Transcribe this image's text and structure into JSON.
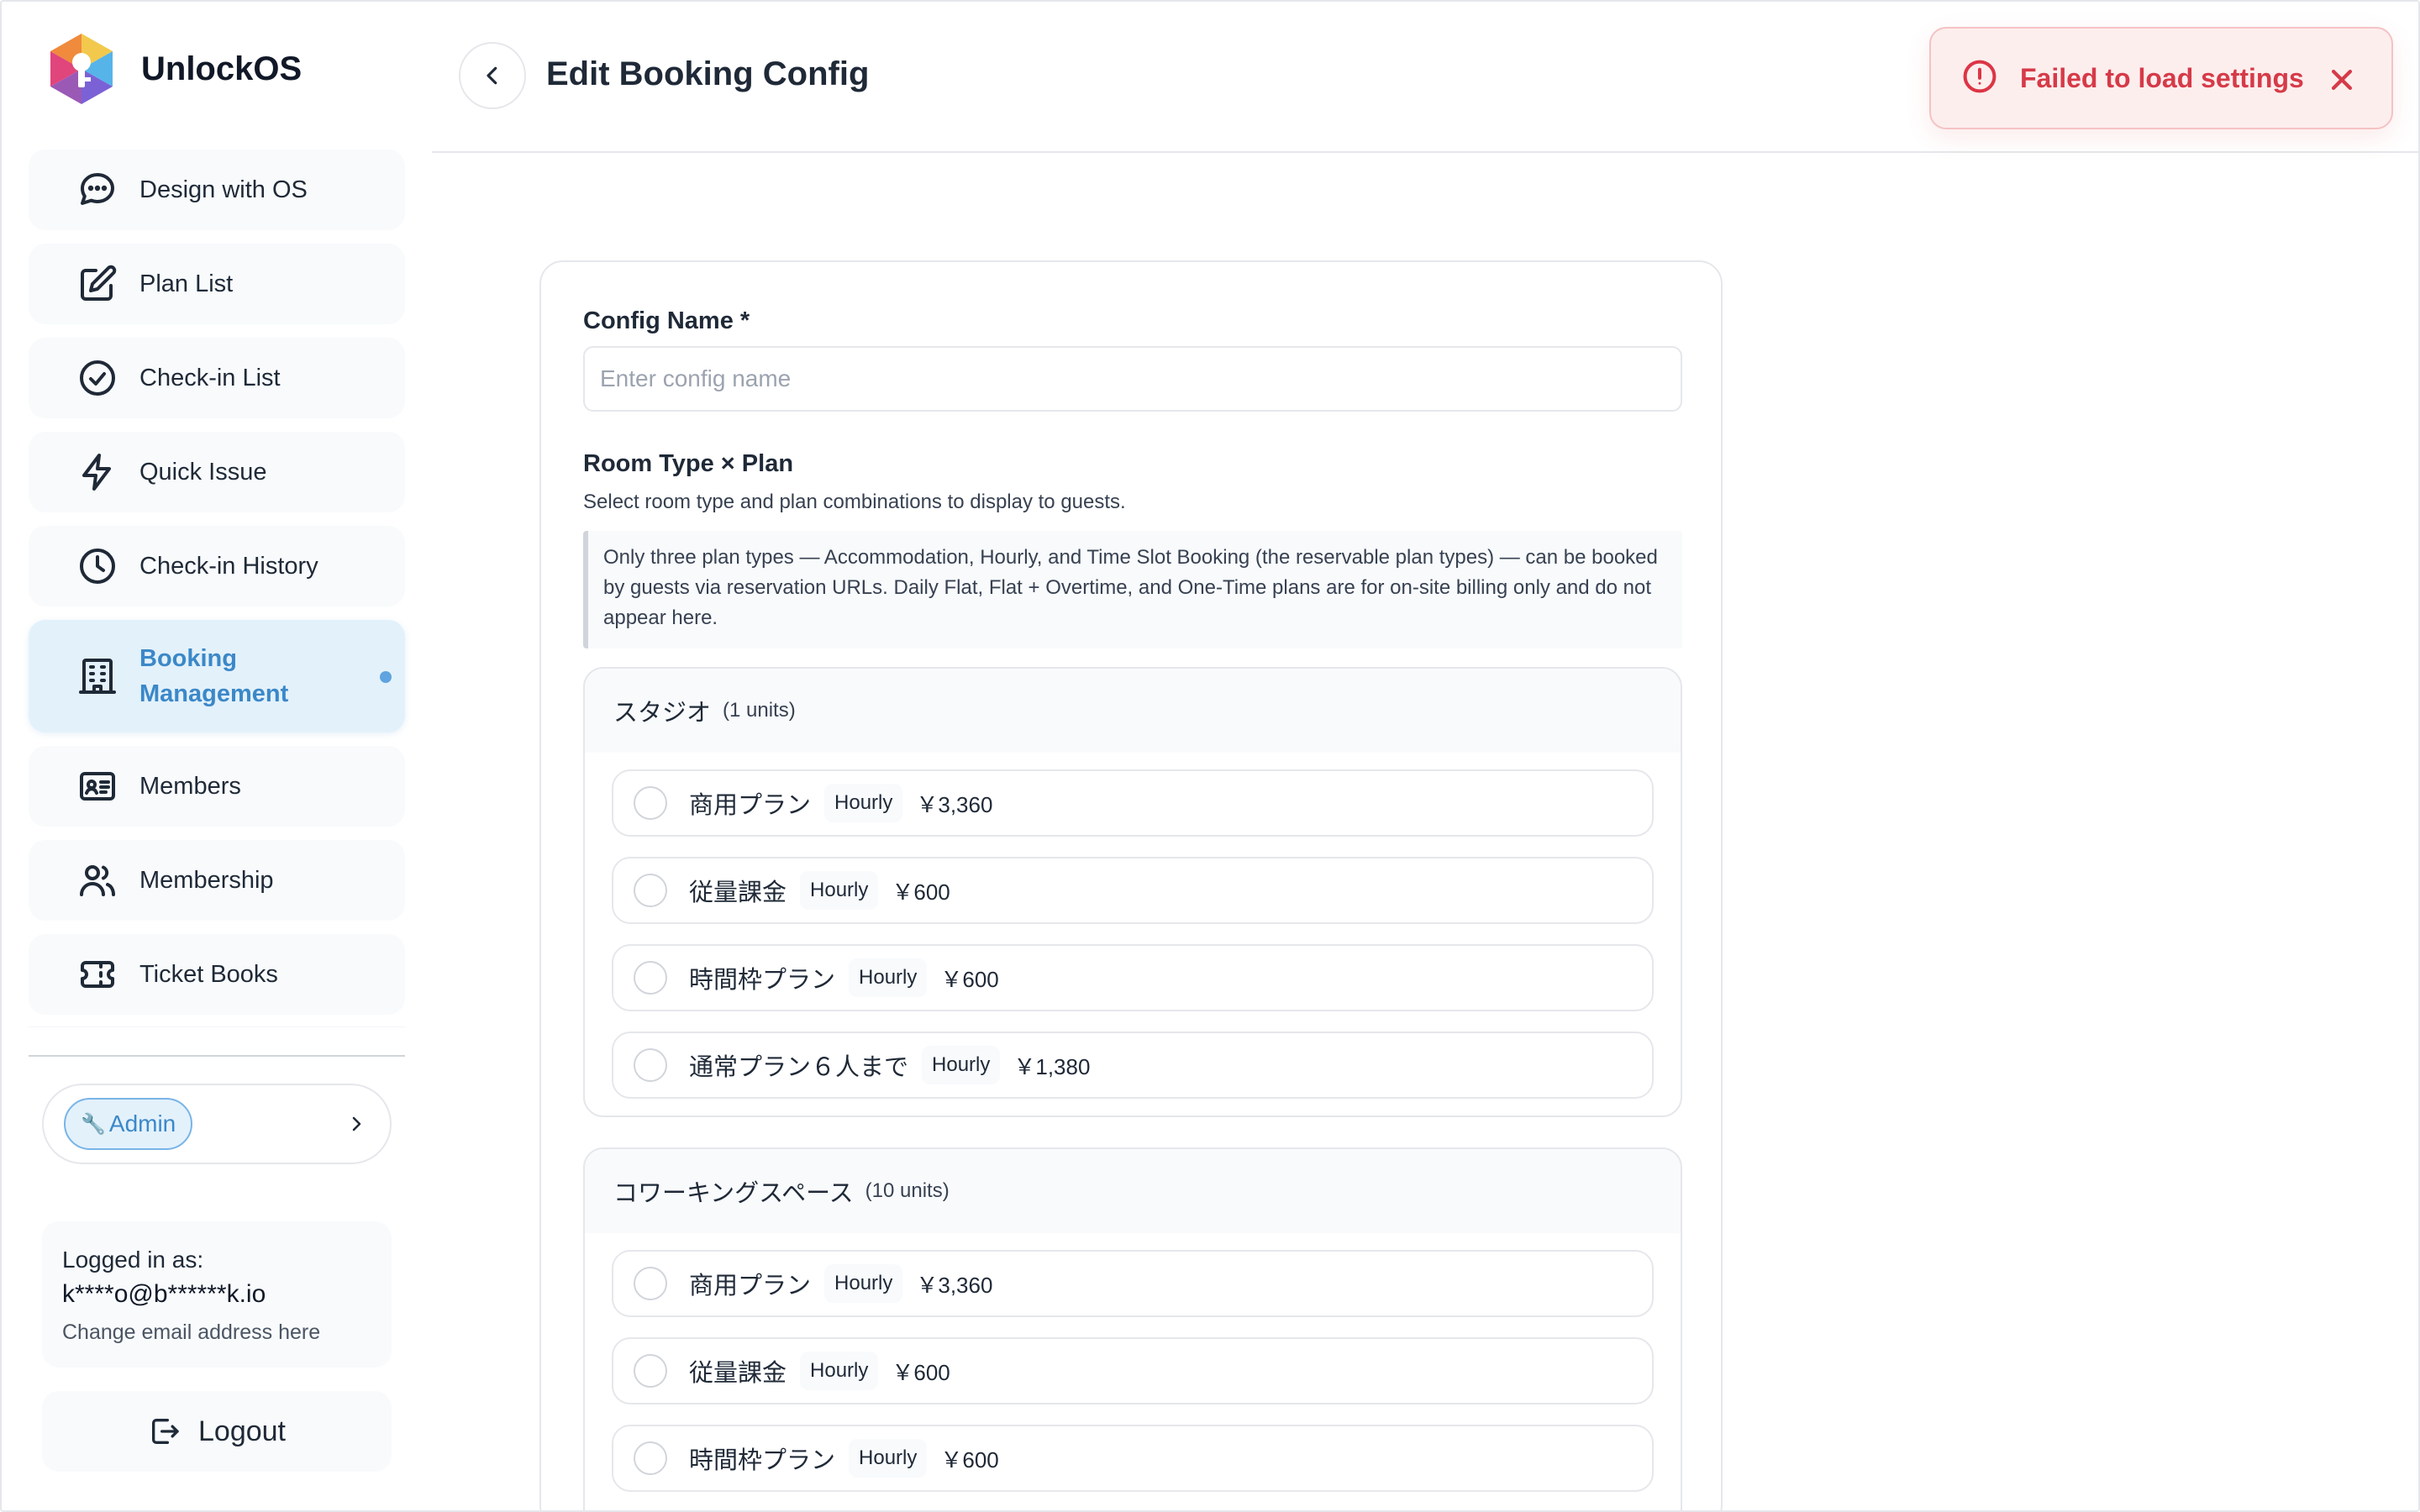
{
  "app": {
    "name": "UnlockOS"
  },
  "sidebar": {
    "items": [
      {
        "label": "Design with OS",
        "icon": "chat-bubble-icon"
      },
      {
        "label": "Plan List",
        "icon": "edit-icon"
      },
      {
        "label": "Check-in List",
        "icon": "check-circle-icon"
      },
      {
        "label": "Quick Issue",
        "icon": "lightning-icon"
      },
      {
        "label": "Check-in History",
        "icon": "clock-icon"
      },
      {
        "label": "Booking\nManagement",
        "icon": "building-icon",
        "active": true
      },
      {
        "label": "Members",
        "icon": "id-card-icon"
      },
      {
        "label": "Membership",
        "icon": "users-icon"
      },
      {
        "label": "Ticket Books",
        "icon": "ticket-icon"
      }
    ],
    "admin": {
      "label": "Admin",
      "icon": "wrench-icon"
    },
    "login": {
      "label": "Logged in as:",
      "email": "k****o@b******k.io",
      "change_link": "Change email address here"
    },
    "logout_label": "Logout"
  },
  "header": {
    "title": "Edit Booking Config",
    "back_icon": "chevron-left-icon"
  },
  "toast": {
    "message": "Failed to load settings",
    "color": "#d63a48"
  },
  "form": {
    "config_name_label": "Config Name",
    "config_name_required": "*",
    "config_name_placeholder": "Enter config name",
    "config_name_value": "",
    "room_plan_title": "Room Type × Plan",
    "room_plan_subtitle": "Select room type and plan combinations to display to guests.",
    "notice": "Only three plan types — Accommodation, Hourly, and Time Slot Booking (the reservable plan types) — can be booked by guests via reservation URLs. Daily Flat, Flat + Overtime, and One-Time plans are for on-site billing only and do not appear here."
  },
  "room_types": [
    {
      "name": "スタジオ",
      "units": "(1 units)",
      "plans": [
        {
          "name": "商用プラン",
          "type": "Hourly",
          "price": "￥3,360",
          "selected": false
        },
        {
          "name": "従量課金",
          "type": "Hourly",
          "price": "￥600",
          "selected": false
        },
        {
          "name": "時間枠プラン",
          "type": "Hourly",
          "price": "￥600",
          "selected": false
        },
        {
          "name": "通常プラン６人まで",
          "type": "Hourly",
          "price": "￥1,380",
          "selected": false
        }
      ]
    },
    {
      "name": "コワーキングスペース",
      "units": "(10 units)",
      "plans": [
        {
          "name": "商用プラン",
          "type": "Hourly",
          "price": "￥3,360",
          "selected": false
        },
        {
          "name": "従量課金",
          "type": "Hourly",
          "price": "￥600",
          "selected": false
        },
        {
          "name": "時間枠プラン",
          "type": "Hourly",
          "price": "￥600",
          "selected": false
        }
      ]
    }
  ],
  "colors": {
    "accent": "#3b88c8",
    "active_bg": "#e3f1fb",
    "error": "#d63a48"
  }
}
